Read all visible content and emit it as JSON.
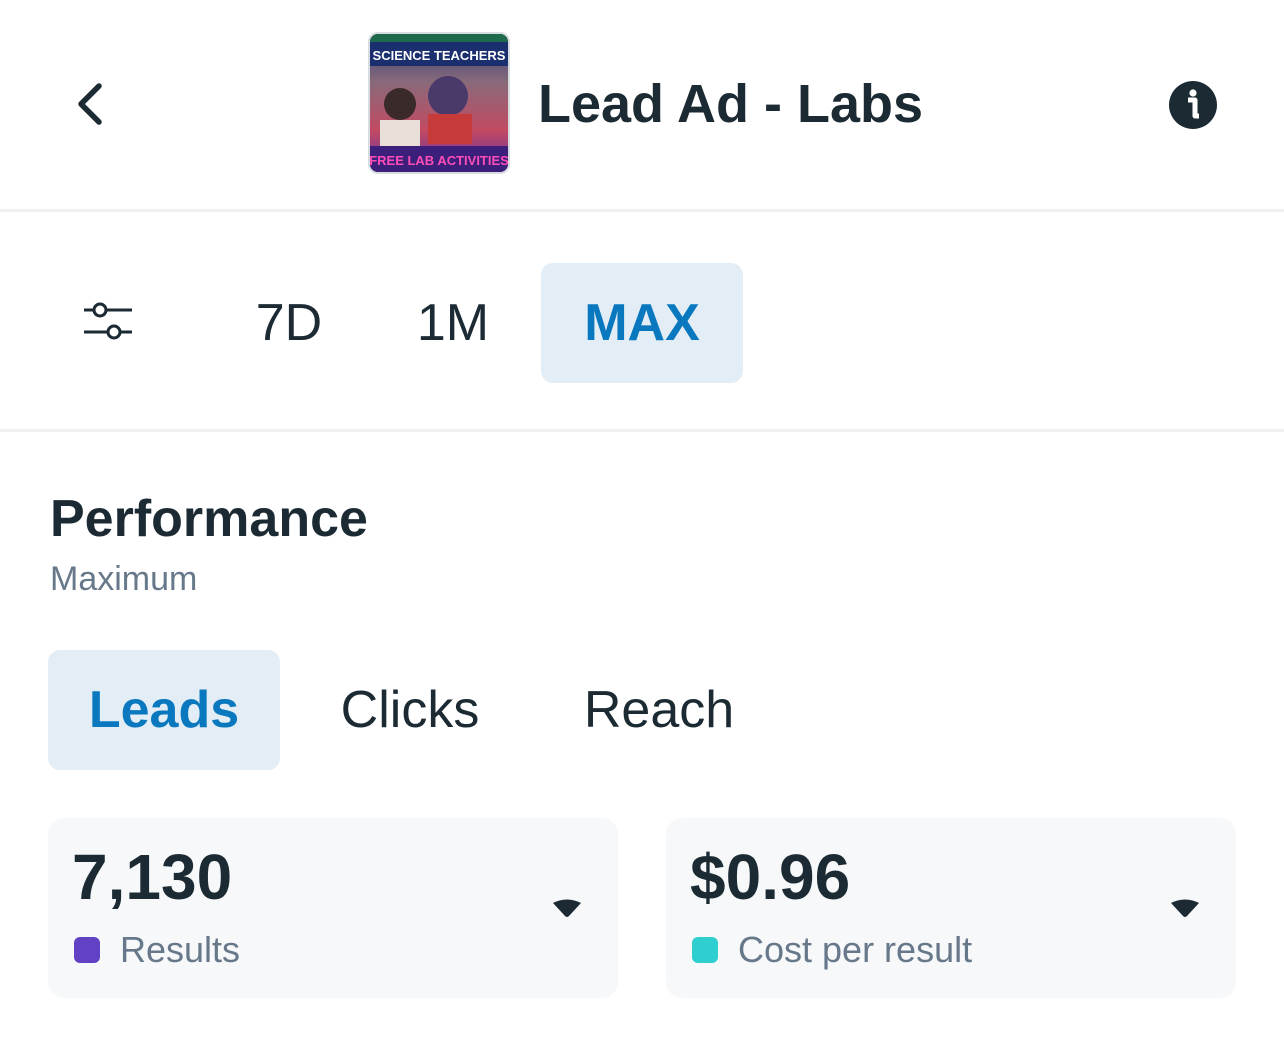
{
  "header": {
    "title": "Lead Ad - Labs",
    "back_icon": "chevron-left-icon",
    "info_icon": "info-icon",
    "thumbnail": {
      "top_text": "SCIENCE TEACHERS",
      "bottom_text": "FREE LAB ACTIVITIES"
    }
  },
  "date_range": {
    "filter_icon": "sliders-icon",
    "options": [
      "7D",
      "1M",
      "MAX"
    ],
    "selected": "MAX"
  },
  "performance": {
    "title": "Performance",
    "subtitle": "Maximum",
    "tabs": [
      "Leads",
      "Clicks",
      "Reach"
    ],
    "selected_tab": "Leads"
  },
  "metrics": [
    {
      "value": "7,130",
      "label": "Results",
      "color": "#6141c4"
    },
    {
      "value": "$0.96",
      "label": "Cost per result",
      "color": "#2fcfcf"
    }
  ],
  "colors": {
    "accent": "#0a78be",
    "active_bg": "#e2edf6",
    "text": "#1c2b33",
    "muted": "#67788a",
    "card_bg": "#f6f8fa"
  }
}
